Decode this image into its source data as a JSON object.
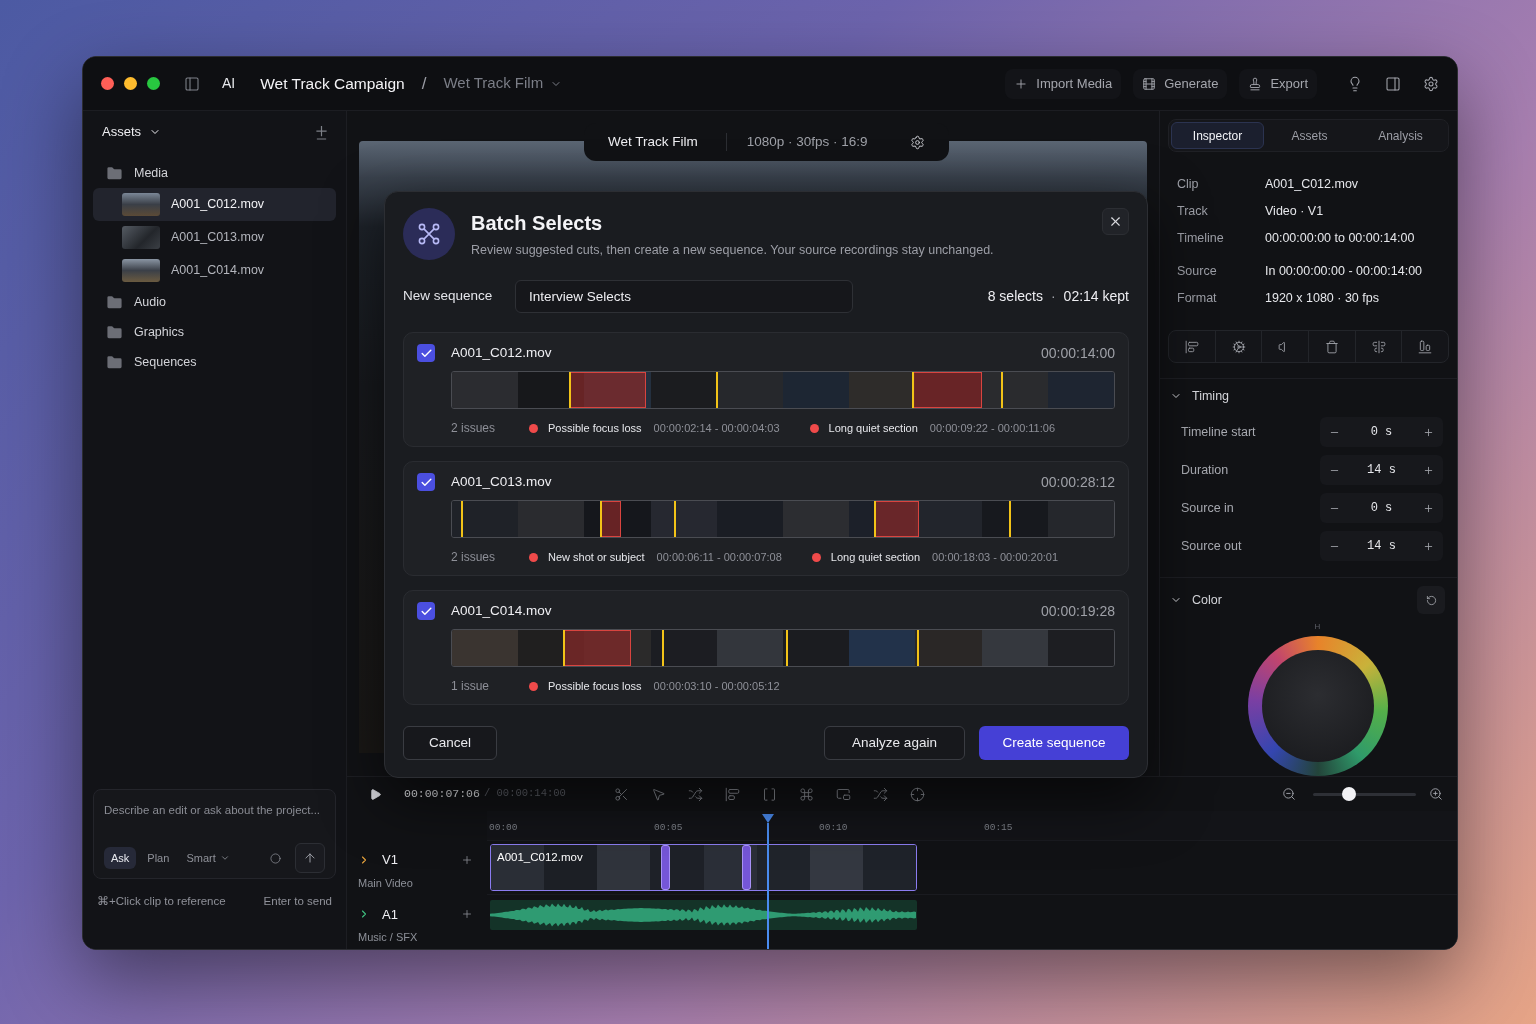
{
  "title_bar": {
    "app_label": "AI",
    "project": "Wet Track Campaign",
    "separator": "/",
    "sequence": "Wet Track Film",
    "actions": [
      {
        "kind": "import",
        "label": "Import Media"
      },
      {
        "kind": "generate",
        "label": "Generate"
      },
      {
        "kind": "export",
        "label": "Export"
      }
    ]
  },
  "sidebar": {
    "title": "Assets",
    "items": [
      {
        "kind": "folder",
        "label": "Media",
        "selected": false,
        "children": [
          {
            "kind": "file",
            "label": "A001_C012.mov",
            "selected": true
          },
          {
            "kind": "file",
            "label": "A001_C013.mov",
            "selected": false
          },
          {
            "kind": "file",
            "label": "A001_C014.mov",
            "selected": false
          }
        ]
      },
      {
        "kind": "folder",
        "label": "Audio",
        "selected": false
      },
      {
        "kind": "folder",
        "label": "Graphics",
        "selected": false
      },
      {
        "kind": "folder",
        "label": "Sequences",
        "selected": false
      }
    ]
  },
  "assistant": {
    "placeholder": "Describe an edit or ask about the project...",
    "modes": [
      {
        "label": "Ask",
        "selected": true
      },
      {
        "label": "Plan",
        "selected": false
      }
    ],
    "model": "Smart",
    "hint": "⌘+Click clip to reference",
    "send_hint": "Enter to send"
  },
  "viewer": {
    "title": "Wet Track Film",
    "format": "1080p · 30fps · 16:9"
  },
  "dialog": {
    "title": "Batch Selects",
    "subtitle": "Review suggested cuts, then create a new sequence. Your source recordings stay unchanged.",
    "sequence_label": "New sequence",
    "sequence_name": "Interview Selects",
    "summary": {
      "selects": "8 selects",
      "separator": "·",
      "kept": "02:14 kept"
    },
    "clips": [
      {
        "name": "A001_C012.mov",
        "checked": true,
        "duration": "00:00:14:00",
        "issue_count": "2 issues",
        "issues": [
          {
            "label": "Possible focus loss",
            "range": "00:00:02:14 - 00:00:04:03"
          },
          {
            "label": "Long quiet section",
            "range": "00:00:09:22 - 00:00:11:06"
          }
        ]
      },
      {
        "name": "A001_C013.mov",
        "checked": true,
        "duration": "00:00:28:12",
        "issue_count": "2 issues",
        "issues": [
          {
            "label": "New shot or subject",
            "range": "00:00:06:11 - 00:00:07:08"
          },
          {
            "label": "Long quiet section",
            "range": "00:00:18:03 - 00:00:20:01"
          }
        ]
      },
      {
        "name": "A001_C014.mov",
        "checked": true,
        "duration": "00:00:19:28",
        "issue_count": "1 issue",
        "issues": [
          {
            "label": "Possible focus loss",
            "range": "00:00:03:10 - 00:00:05:12"
          }
        ]
      }
    ],
    "buttons": [
      {
        "kind": "secondary",
        "label": "Cancel"
      },
      {
        "kind": "outline",
        "label": "Analyze again"
      },
      {
        "kind": "primary",
        "label": "Create sequence"
      }
    ]
  },
  "inspector": {
    "tabs": [
      {
        "label": "Inspector",
        "selected": true
      },
      {
        "label": "Assets",
        "selected": false
      },
      {
        "label": "Analysis",
        "selected": false
      }
    ],
    "property_groups": [
      [
        {
          "label": "Clip",
          "value": "A001_C012.mov"
        },
        {
          "label": "Track",
          "value": "Video · V1"
        },
        {
          "label": "Timeline",
          "value": "00:00:00:00 to 00:00:14:00"
        }
      ],
      [
        {
          "label": "Source",
          "value": "In 00:00:00:00 - 00:00:14:00"
        },
        {
          "label": "Format",
          "value": "1920 x 1080 · 30 fps"
        }
      ]
    ],
    "timing": {
      "title": "Timing",
      "expanded": true,
      "fields": [
        {
          "label": "Timeline start",
          "value": "0 s"
        },
        {
          "label": "Duration",
          "value": "14 s"
        },
        {
          "label": "Source in",
          "value": "0 s"
        },
        {
          "label": "Source out",
          "value": "14 s"
        }
      ]
    },
    "color": {
      "title": "Color",
      "expanded": true,
      "hue_label": "H"
    }
  },
  "timeline": {
    "timecode": "00:00:07:06",
    "duration": "/ 00:00:14:00",
    "zoom": {
      "level": 0.35
    },
    "ruler": [
      "00:00",
      "00:05",
      "00:10",
      "00:15"
    ],
    "playhead": {
      "level": 0.29
    },
    "tracks": [
      {
        "kind": "video",
        "name": "V1",
        "description": "Main Video",
        "clips": [
          {
            "name": "A001_C012.mov"
          }
        ]
      },
      {
        "kind": "audio",
        "name": "A1",
        "description": "Music / SFX"
      }
    ]
  }
}
